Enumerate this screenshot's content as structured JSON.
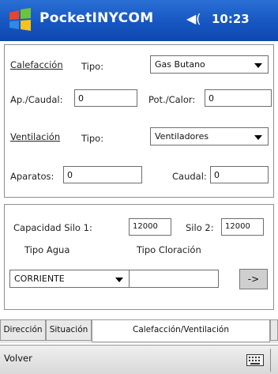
{
  "window": {
    "title": "PocketINYCOM",
    "time": "10:23",
    "speaker_icon": "speaker-icon",
    "start_icon": "windows-flag-icon"
  },
  "heating": {
    "heading": "Calefacción",
    "tipo_label": "Tipo:",
    "tipo_value": "Gas Butano",
    "ap_caudal_label": "Ap./Caudal:",
    "ap_caudal_value": "0",
    "pot_calor_label": "Pot./Calor:",
    "pot_calor_value": "0"
  },
  "ventilation": {
    "heading": "Ventilación",
    "tipo_label": "Tipo:",
    "tipo_value": "Ventiladores",
    "aparatos_label": "Aparatos:",
    "aparatos_value": "0",
    "caudal_label": "Caudal:",
    "caudal_value": "0"
  },
  "capacity": {
    "silo1_label": "Capacidad Silo 1:",
    "silo1_value": "12000",
    "silo2_label": "Silo 2:",
    "silo2_value": "12000",
    "tipo_agua_label": "Tipo Agua",
    "tipo_cloracion_label": "Tipo Cloración",
    "tipo_agua_value": "CORRIENTE",
    "tipo_cloracion_value": "",
    "go_button": "->"
  },
  "tabs": [
    {
      "label": "Dirección"
    },
    {
      "label": "Situación"
    },
    {
      "label": "Calefacción/Ventilación"
    }
  ],
  "menu": {
    "back_label": "Volver",
    "keyboard_icon": "keyboard-icon"
  },
  "colors": {
    "titlebar": "#1656c2",
    "panel_border": "#8f8f8f",
    "menubar": "#d9d9d9"
  }
}
